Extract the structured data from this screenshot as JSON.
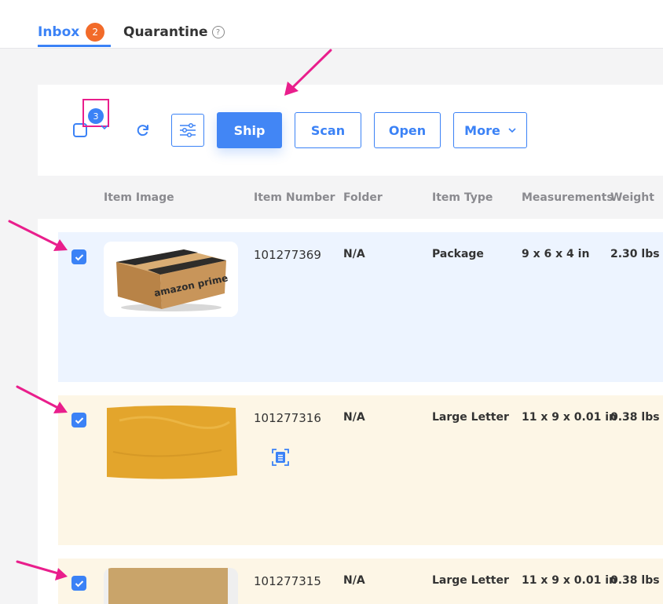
{
  "tabs": [
    {
      "label": "Inbox",
      "badge": "2"
    },
    {
      "label": "Quarantine",
      "help": "?"
    }
  ],
  "toolbar": {
    "selected_count": "3",
    "ship_label": "Ship",
    "scan_label": "Scan",
    "open_label": "Open",
    "more_label": "More"
  },
  "table": {
    "columns": [
      "Item Image",
      "Item Number",
      "Folder",
      "Item Type",
      "Measurements",
      "Weight"
    ],
    "rows": [
      {
        "image_text": "amazon prime",
        "item_number": "101277369",
        "folder": "N/A",
        "item_type": "Package",
        "measurements": "9 x 6 x 4 in",
        "weight": "2.30 lbs"
      },
      {
        "item_number": "101277316",
        "folder": "N/A",
        "item_type": "Large Letter",
        "measurements": "11 x 9 x 0.01 in",
        "weight": "0.38 lbs"
      },
      {
        "item_number": "101277315",
        "folder": "N/A",
        "item_type": "Large Letter",
        "measurements": "11 x 9 x 0.01 in",
        "weight": "0.38 lbs"
      }
    ]
  },
  "colors": {
    "accent": "#3b82f6",
    "badge": "#f26b2a",
    "annotation": "#e91e8c",
    "selected_row": "#edf4ff",
    "letter_row": "#fdf6e6"
  }
}
